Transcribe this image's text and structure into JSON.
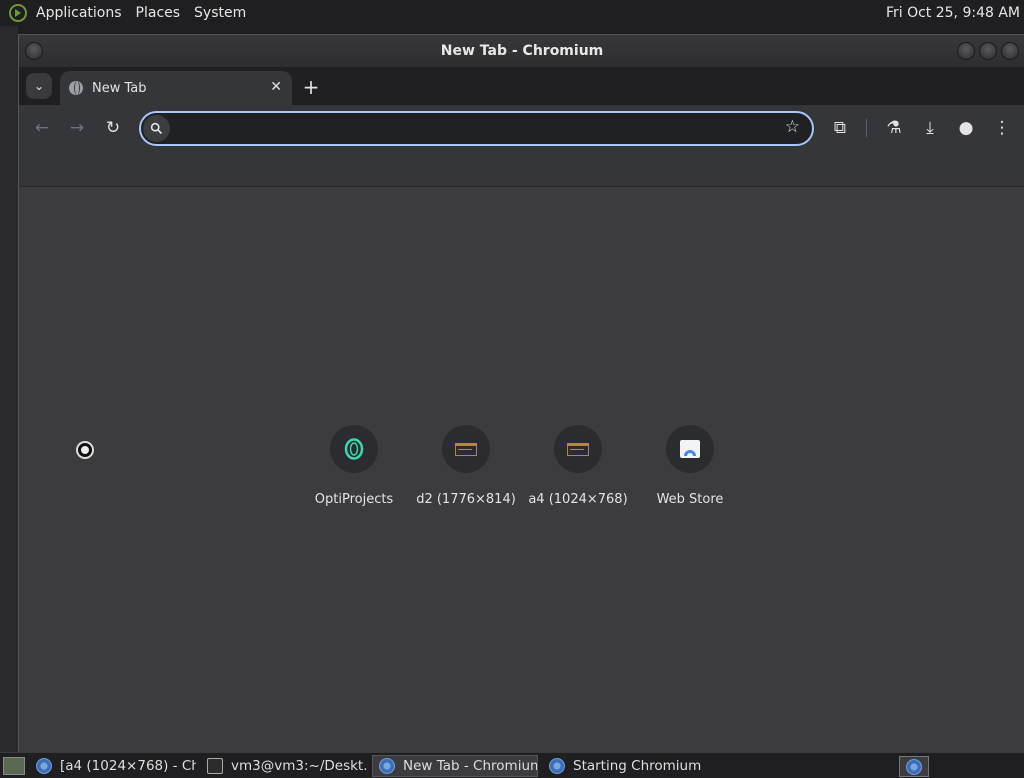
{
  "top_panel": {
    "menus": [
      "Applications",
      "Places",
      "System"
    ],
    "clock": "Fri Oct 25,  9:48 AM"
  },
  "window": {
    "title": "New Tab - Chromium"
  },
  "tabs": [
    {
      "label": "New Tab",
      "icon": "globe-icon",
      "active": true
    }
  ],
  "toolbar": {
    "back_icon": "←",
    "forward_icon": "→",
    "reload_icon": "↻",
    "omnibox_value": "",
    "star_icon": "☆",
    "extensions_icon": "⧉",
    "labs_icon": "⚗",
    "download_icon": "⤓",
    "profile_icon": "●",
    "menu_icon": "⋮"
  },
  "shortcuts": [
    {
      "label": "OptiProjects",
      "icon": "optiprojects-icon"
    },
    {
      "label": "d2 (1776×814)",
      "icon": "page-thumb-icon"
    },
    {
      "label": "a4 (1024×768)",
      "icon": "page-thumb-icon"
    },
    {
      "label": "Web Store",
      "icon": "web-store-icon"
    }
  ],
  "taskbar": {
    "tasks": [
      {
        "label": "[a4 (1024×768) - Ch...",
        "icon": "chromium-icon",
        "active": false
      },
      {
        "label": "vm3@vm3:~/Deskt...",
        "icon": "terminal-icon",
        "active": false
      },
      {
        "label": "New Tab - Chromium",
        "icon": "chromium-icon",
        "active": true
      },
      {
        "label": "Starting Chromium",
        "icon": "chromium-icon",
        "active": false
      }
    ]
  }
}
